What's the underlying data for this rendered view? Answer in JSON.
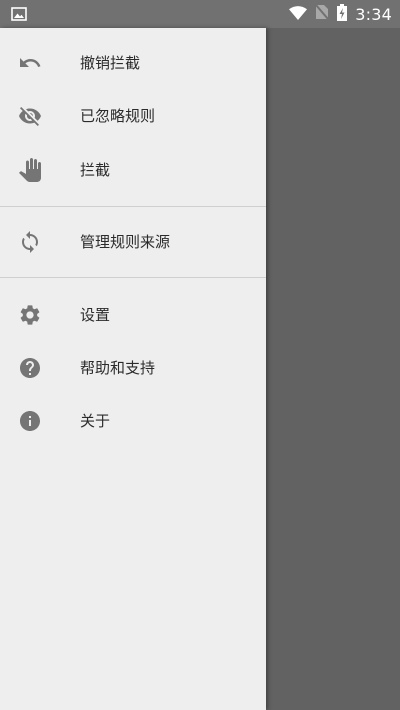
{
  "status_bar": {
    "time": "3:34",
    "left_icon": "image-notification-icon",
    "icons": [
      "wifi-icon",
      "no-sim-icon",
      "battery-charging-icon"
    ],
    "background": "#717171"
  },
  "drawer": {
    "background": "#eeeeee",
    "sections": [
      [
        {
          "icon": "undo-icon",
          "label": "撤销拦截"
        },
        {
          "icon": "eye-off-icon",
          "label": "已忽略规则"
        },
        {
          "icon": "hand-icon",
          "label": "拦截"
        }
      ],
      [
        {
          "icon": "sync-icon",
          "label": "管理规则来源"
        }
      ],
      [
        {
          "icon": "gear-icon",
          "label": "设置"
        },
        {
          "icon": "help-icon",
          "label": "帮助和支持"
        },
        {
          "icon": "info-icon",
          "label": "关于"
        }
      ]
    ]
  },
  "scrim_color": "#626262"
}
